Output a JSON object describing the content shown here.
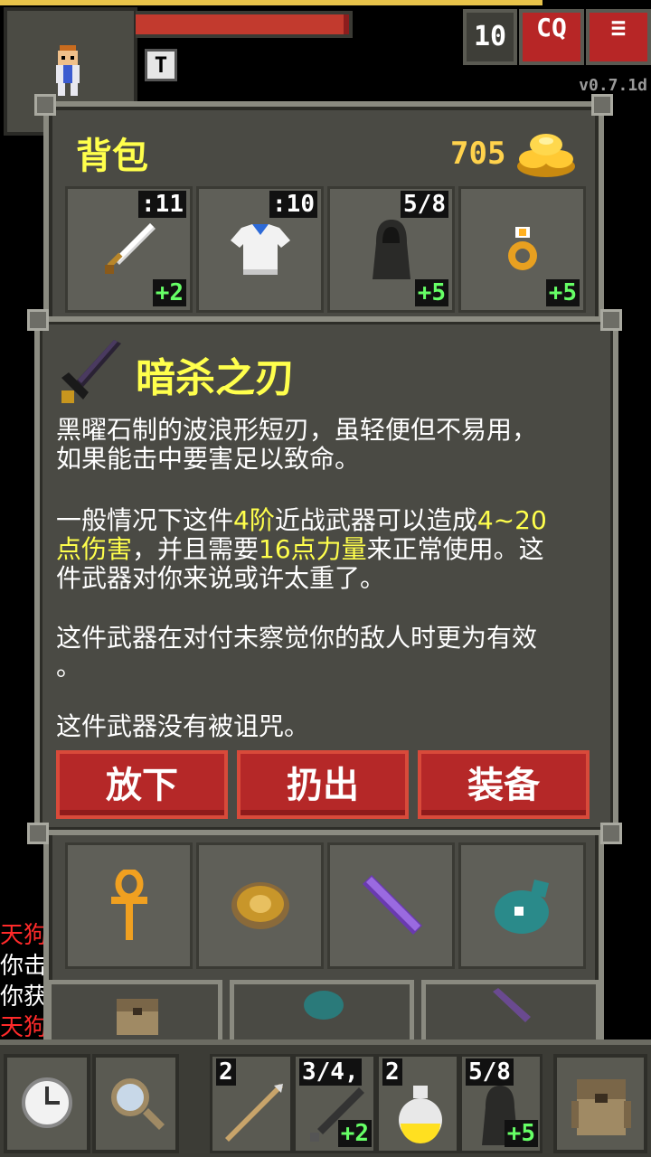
{
  "hud": {
    "depth": "10",
    "journal_label": "CQ",
    "menu_label": "≡",
    "version": "v0.7.1d",
    "buff_letter": "T"
  },
  "backpack": {
    "title": "背包",
    "gold": "705",
    "equipped": [
      {
        "name": "sword-icon",
        "top": ":11",
        "bottom": "+2"
      },
      {
        "name": "armor-icon",
        "top": ":10",
        "bottom": ""
      },
      {
        "name": "cloak-icon",
        "top": "5/8",
        "bottom": "+5"
      },
      {
        "name": "ring-icon",
        "top": "",
        "bottom": "+5"
      }
    ],
    "items": [
      {
        "name": "ankh-icon"
      },
      {
        "name": "scroll-holder-icon"
      },
      {
        "name": "wand-icon"
      },
      {
        "name": "seed-pouch-icon"
      }
    ]
  },
  "item_info": {
    "title": "暗杀之刃",
    "desc1_line1": "黑曜石制的波浪形短刃，虽轻便但不易用，",
    "desc1_line2": "如果能击中要害足以致命。",
    "desc2_a": "一般情况下这件",
    "desc2_b": "4阶",
    "desc2_c": "近战武器可以造成",
    "desc2_d": "4~20",
    "desc2_e": "点伤害",
    "desc2_f": "，并且需要",
    "desc2_g": "16点力量",
    "desc2_h": "来正常使用。这",
    "desc2_i": "件武器对你来说或许太重了。",
    "desc3_line1": "这件武器在对付未察觉你的敌人时更为有效",
    "desc3_line2": "。",
    "desc4": "这件武器没有被诅咒。",
    "actions": [
      "放下",
      "扔出",
      "装备"
    ]
  },
  "log": [
    "天狗",
    "你击",
    "你获",
    "天狗"
  ],
  "quickslots": [
    {
      "name": "spear-icon",
      "top": "2",
      "bottom": ""
    },
    {
      "name": "dagger-icon",
      "top": "3/4,",
      "bottom": "+2"
    },
    {
      "name": "potion-icon",
      "top": "2",
      "bottom": ""
    },
    {
      "name": "cloak-icon",
      "top": "5/8",
      "bottom": "+5"
    }
  ],
  "colors": {
    "accent_yellow": "#ffff4c",
    "button_red": "#b52828",
    "bonus_green": "#66ff66"
  }
}
